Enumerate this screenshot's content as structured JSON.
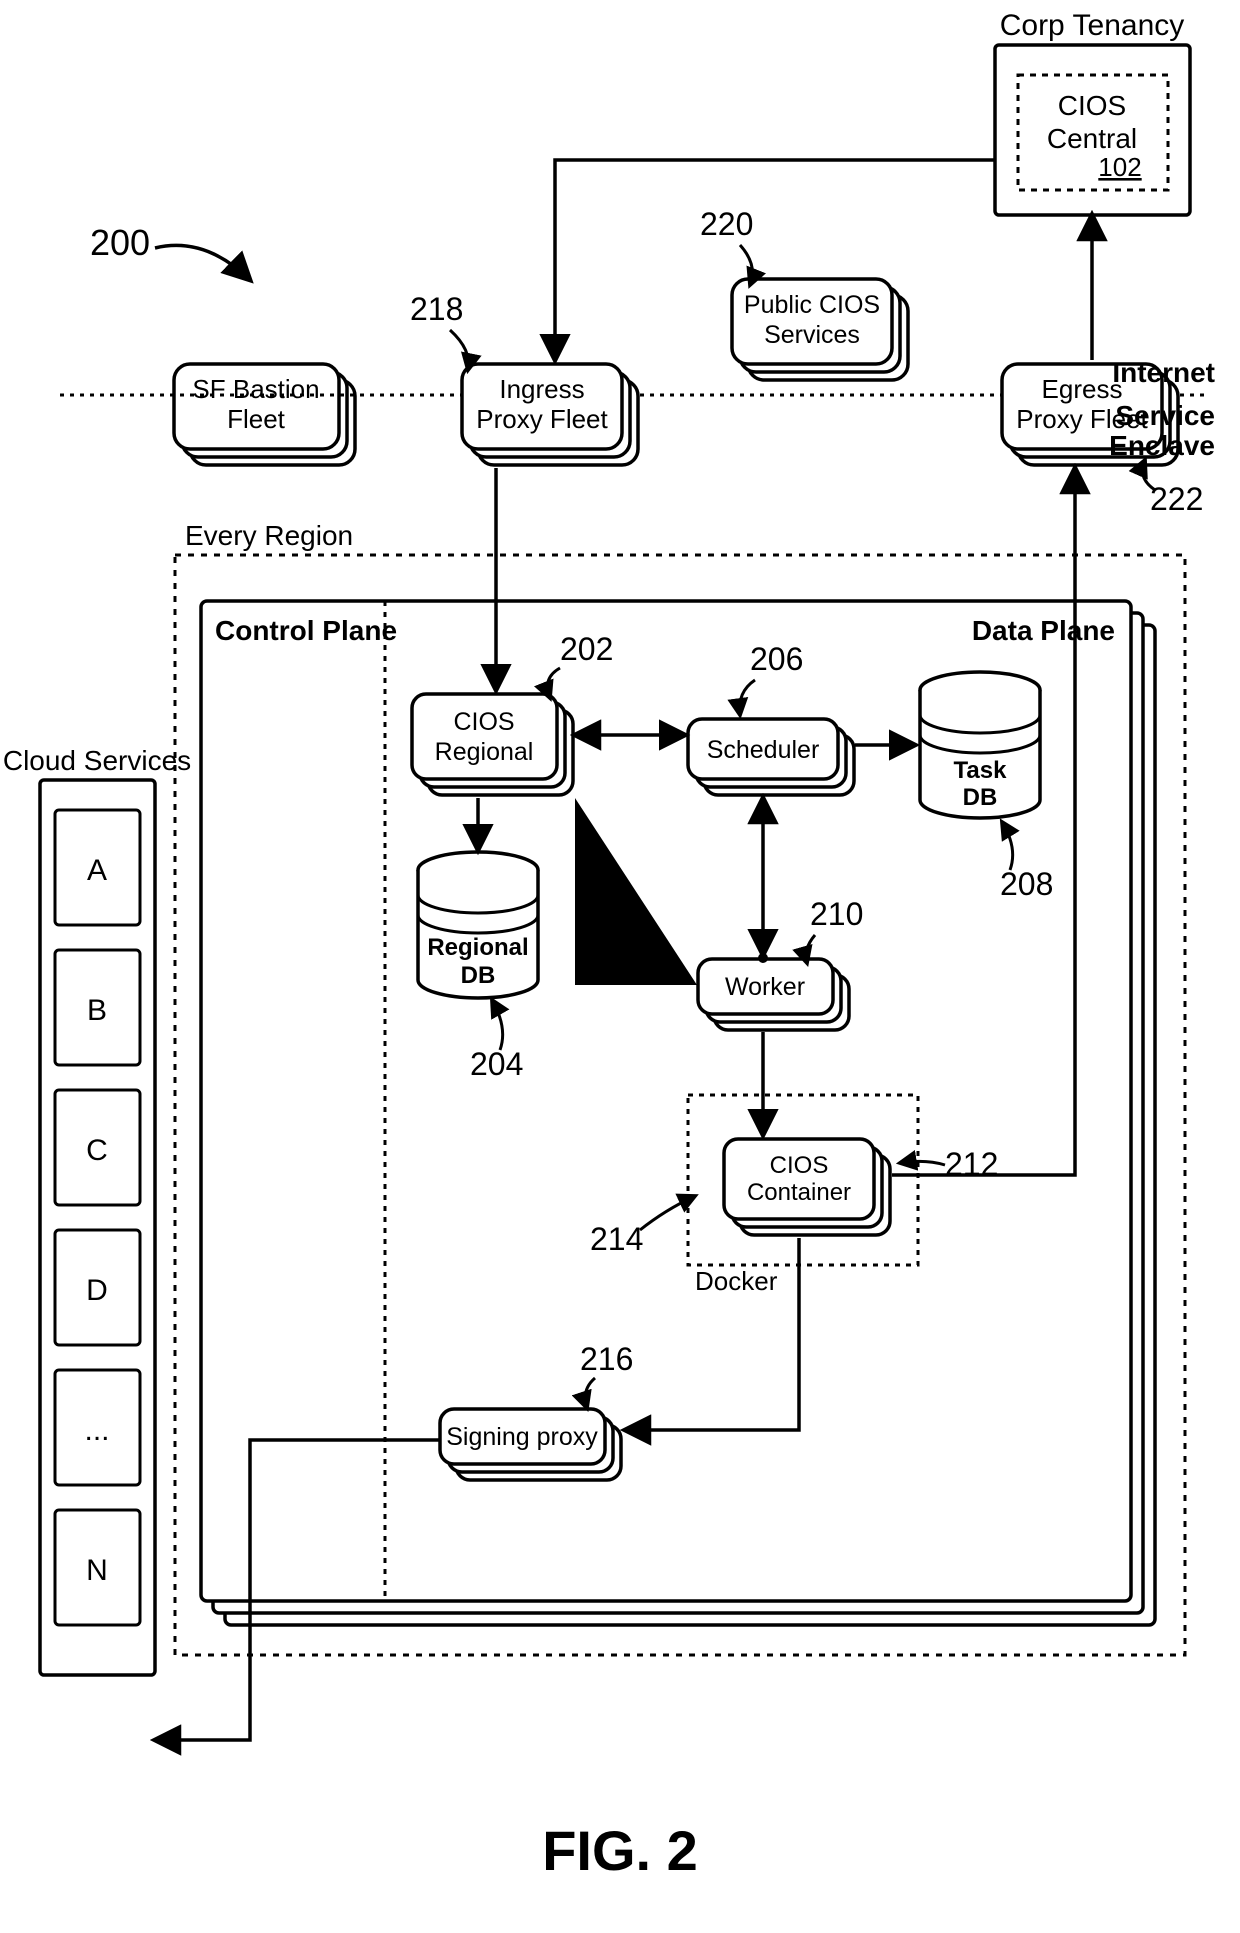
{
  "figure_label": "FIG. 2",
  "ref_200": "200",
  "corp_tenancy": "Corp Tenancy",
  "cios_central": "CIOS Central",
  "cios_central_num": "102",
  "sf_bastion_fleet": "SF Bastion Fleet",
  "ingress_proxy_fleet": "Ingress Proxy Fleet",
  "public_cios_services": "Public CIOS Services",
  "egress_proxy_fleet": "Egress Proxy Fleet",
  "internet": "Internet",
  "service_enclave": "Service Enclave",
  "every_region": "Every Region",
  "control_plane": "Control Plane",
  "data_plane": "Data Plane",
  "cios_regional": "CIOS Regional",
  "regional_db": "Regional DB",
  "scheduler": "Scheduler",
  "task_db": "Task DB",
  "worker": "Worker",
  "docker": "Docker",
  "cios_container": "CIOS Container",
  "signing_proxy": "Signing proxy",
  "cloud_services": "Cloud Services",
  "svc_a": "A",
  "svc_b": "B",
  "svc_c": "C",
  "svc_d": "D",
  "svc_dots": "...",
  "svc_n": "N",
  "ref_218": "218",
  "ref_220": "220",
  "ref_222": "222",
  "ref_202": "202",
  "ref_204": "204",
  "ref_206": "206",
  "ref_208": "208",
  "ref_210": "210",
  "ref_212": "212",
  "ref_214": "214",
  "ref_216": "216"
}
